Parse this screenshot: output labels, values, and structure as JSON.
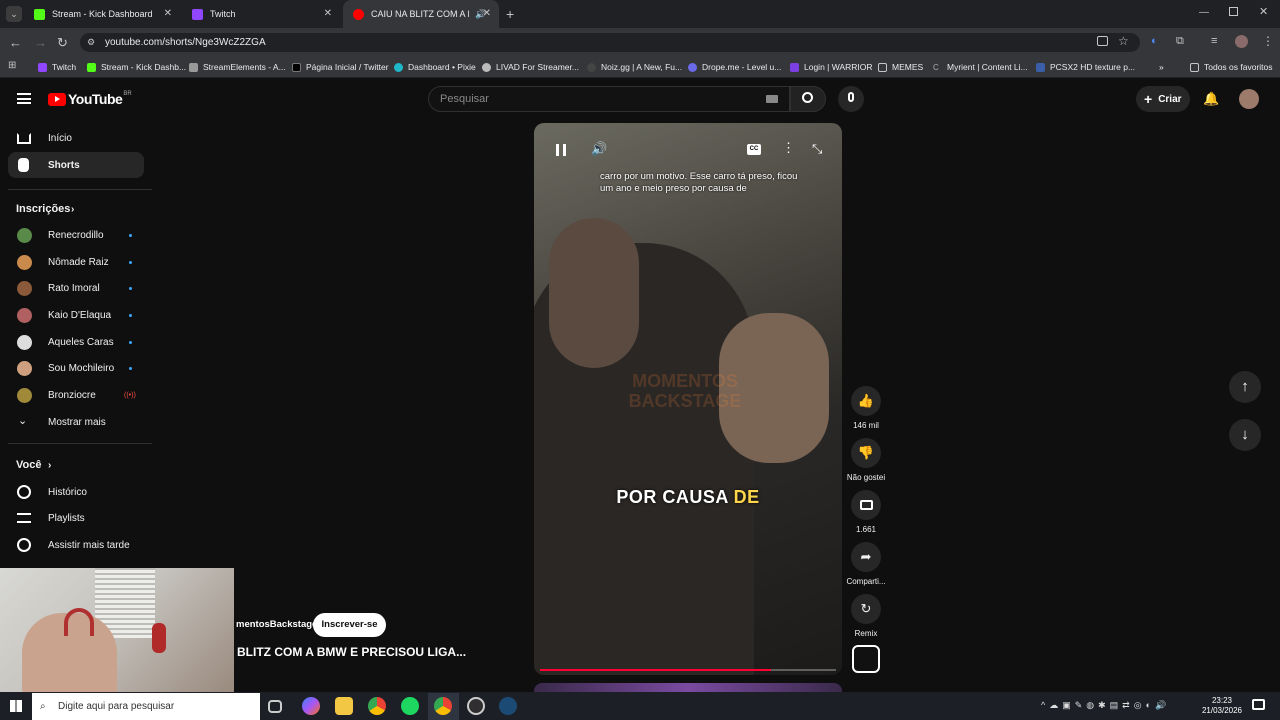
{
  "browser": {
    "tabs": [
      {
        "title": "Stream - Kick Dashboard",
        "color": "#53fc18"
      },
      {
        "title": "Twitch",
        "color": "#9146ff"
      },
      {
        "title": "CAIU NA BLITZ COM A BMW",
        "color": "#ff0000"
      }
    ],
    "url": "youtube.com/shorts/Nge3WcZ2ZGA",
    "bookmarks": [
      "Twitch",
      "Stream - Kick Dashb...",
      "StreamElements - A...",
      "Página Inicial / Twitter",
      "Dashboard • Pixie",
      "LIVAD For Streamer...",
      "Noiz.gg | A New, Fu...",
      "Drope.me - Level u...",
      "Login | WARRIOR",
      "MEMES",
      "Myrient | Content Li...",
      "PCSX2 HD texture p..."
    ],
    "all_favorites": "Todos os favoritos"
  },
  "youtube": {
    "logo": "YouTube",
    "region": "BR",
    "search_placeholder": "Pesquisar",
    "create_label": "Criar",
    "sidebar": {
      "home": "Início",
      "shorts": "Shorts",
      "subscriptions": "Inscrições",
      "channels": [
        {
          "name": "Renecrodillo",
          "color": "#5a8a4a"
        },
        {
          "name": "Nômade Raiz",
          "color": "#c98a4b"
        },
        {
          "name": "Rato Imoral",
          "color": "#8a5a3a"
        },
        {
          "name": "Kaio D'Elaqua",
          "color": "#b06060"
        },
        {
          "name": "Aqueles Caras",
          "color": "#dddddd"
        },
        {
          "name": "Sou Mochileiro",
          "color": "#cfa080"
        },
        {
          "name": "Bronziocre",
          "color": "#a08a3a"
        }
      ],
      "show_more": "Mostrar mais",
      "you": "Você",
      "history": "Histórico",
      "playlists": "Playlists",
      "watch_later": "Assistir mais tarde"
    },
    "video": {
      "caption_top": "carro por um motivo. Esse carro tá preso, ficou um ano e meio preso por causa de",
      "caption_main": "POR CAUSA",
      "caption_highlight": "DE",
      "watermark": "MOMENTOS BACKSTAGE",
      "channel": "mentosBackstage",
      "subscribe": "Inscrever-se",
      "title": "BLITZ COM A BMW E PRECISOU LIGA...",
      "progress": 0.78
    },
    "actions": {
      "likes": "146 mil",
      "dislike": "Não gostei",
      "comments": "1.661",
      "share": "Comparti...",
      "remix": "Remix"
    }
  },
  "taskbar": {
    "search_placeholder": "Digite aqui para pesquisar",
    "time": "23:23",
    "date": "21/03/2026"
  }
}
